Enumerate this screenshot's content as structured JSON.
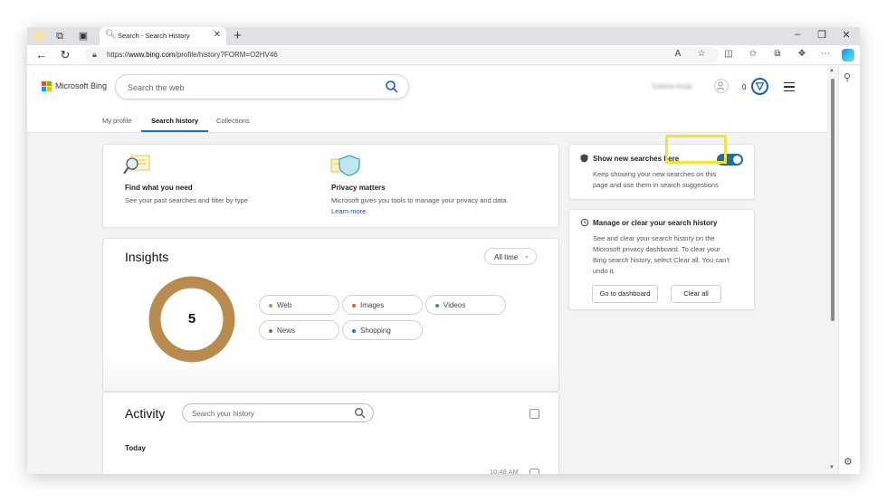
{
  "browser": {
    "tab_title": "Search - Search History",
    "url_prefix": "https://",
    "url_domain": "www.bing.com",
    "url_path": "/profile/history?FORM=O2HV46"
  },
  "header": {
    "brand": "Microsoft Bing",
    "search_placeholder": "Search the web",
    "user_name": "Sabina Andy",
    "points": "0"
  },
  "subnav": {
    "tabs": [
      "My profile",
      "Search history",
      "Collections"
    ],
    "active": "Search history"
  },
  "features": [
    {
      "title": "Find what you need",
      "text": "See your past searches and filter by type"
    },
    {
      "title": "Privacy matters",
      "text": "Microsoft gives you tools to manage your privacy and data.",
      "link": "Learn more"
    }
  ],
  "insights": {
    "title": "Insights",
    "range": "All time",
    "total": "5",
    "ring_color": "#b98b4e",
    "categories": [
      {
        "label": "Web",
        "color": "#b98b4e"
      },
      {
        "label": "Images",
        "color": "#e0573a"
      },
      {
        "label": "Videos",
        "color": "#3a9a4e"
      },
      {
        "label": "News",
        "color": "#7a5fb5"
      },
      {
        "label": "Shopping",
        "color": "#1a7bb8"
      }
    ]
  },
  "activity": {
    "title": "Activity",
    "search_placeholder": "Search your history",
    "group": "Today",
    "first_time": "10:48 AM"
  },
  "show_new": {
    "title": "Show new searches here",
    "text1": "Keep showing your new searches on this",
    "text2": "page and use them in search suggestions",
    "enabled": true
  },
  "manage": {
    "title": "Manage or clear your search history",
    "lines": [
      "See and clear your search history on the",
      "Microsoft privacy dashboard. To clear your",
      "Bing search history, select Clear all. You can't",
      "undo it."
    ],
    "dashboard_button": "Go to dashboard",
    "clear_button": "Clear all",
    "highlight_color": "#f2e53a"
  }
}
